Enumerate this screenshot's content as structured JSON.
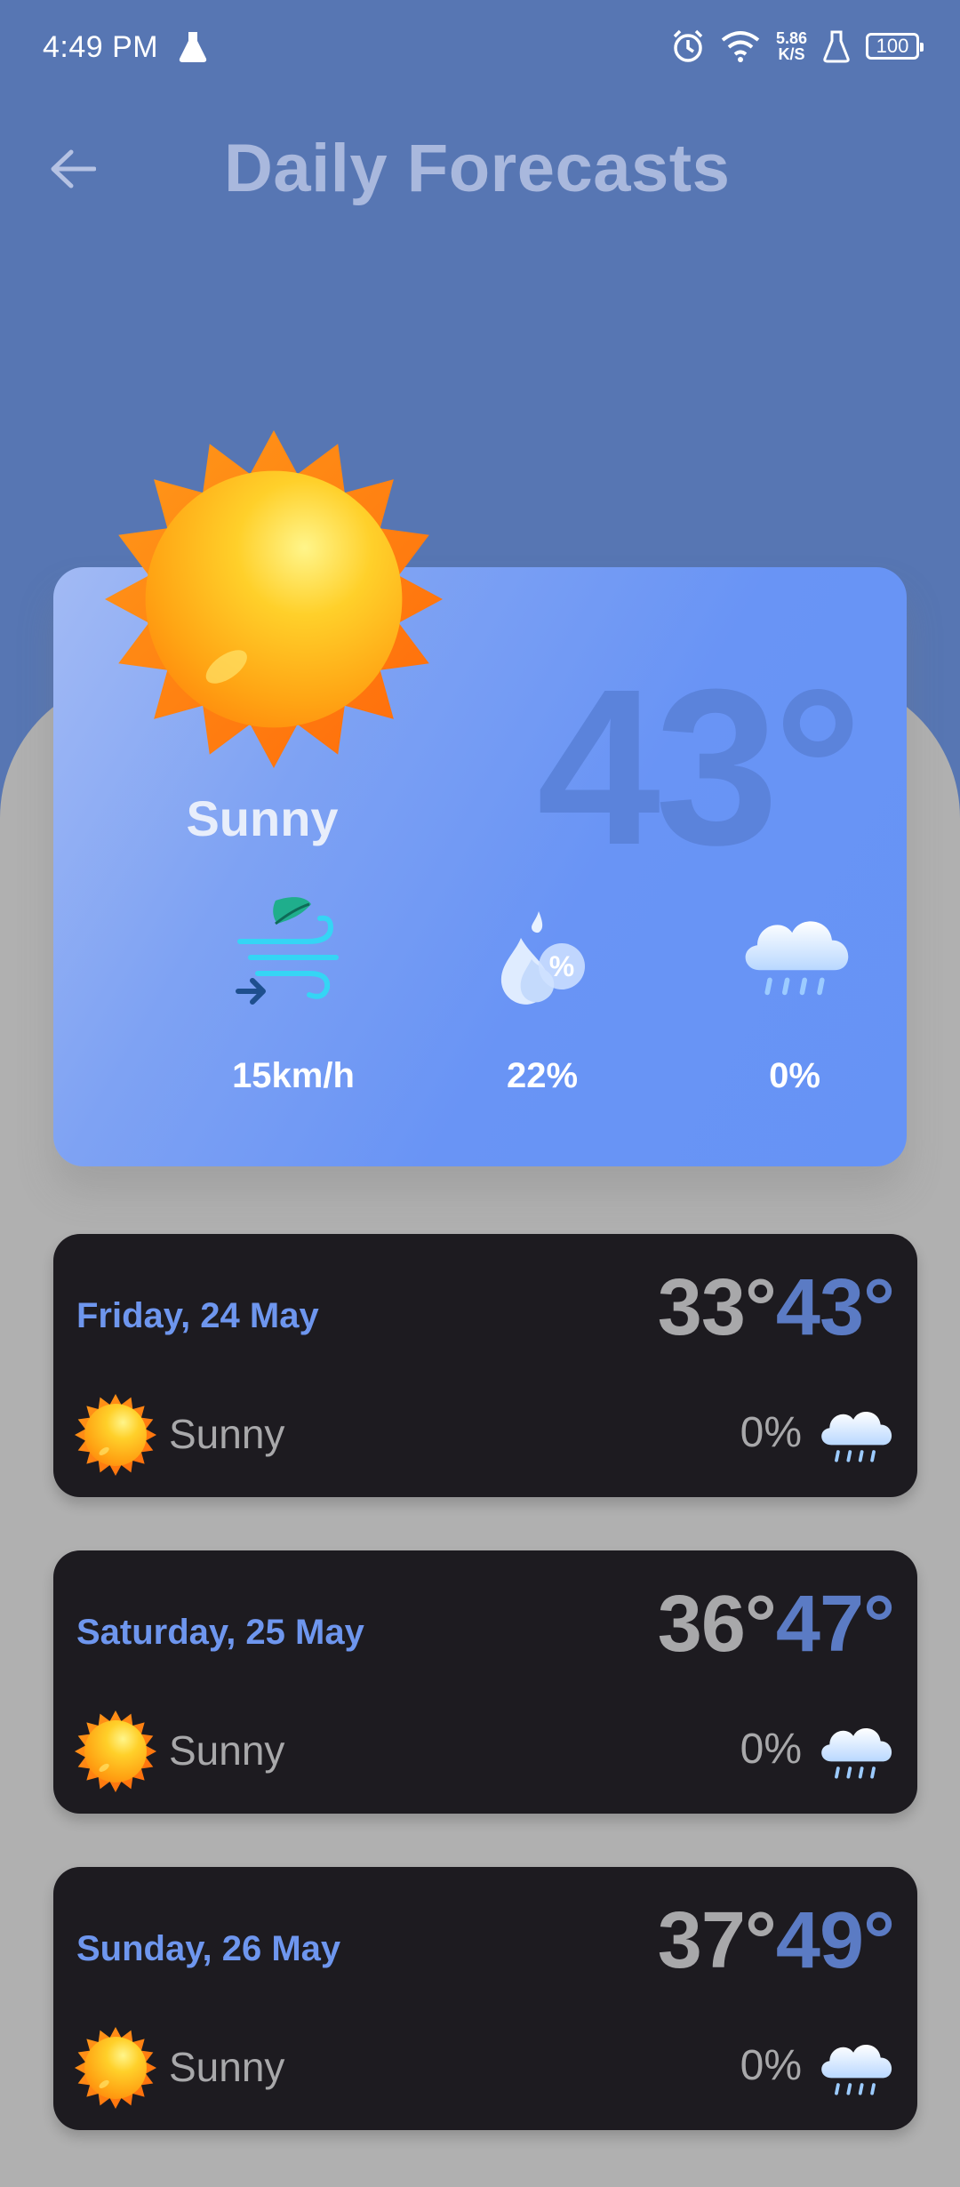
{
  "status_bar": {
    "time": "4:49 PM",
    "speed_value": "5.86",
    "speed_unit": "K/S",
    "battery": "100"
  },
  "header": {
    "title": "Daily Forecasts"
  },
  "today": {
    "temperature": "43°",
    "condition": "Sunny",
    "wind": "15km/h",
    "humidity": "22%",
    "rain_chance": "0%"
  },
  "days": [
    {
      "date": "Friday, 24 May",
      "min": "33°",
      "max": "43°",
      "condition": "Sunny",
      "rain": "0%"
    },
    {
      "date": "Saturday, 25 May",
      "min": "36°",
      "max": "47°",
      "condition": "Sunny",
      "rain": "0%"
    },
    {
      "date": "Sunday, 26 May",
      "min": "37°",
      "max": "49°",
      "condition": "Sunny",
      "rain": "0%"
    }
  ],
  "colors": {
    "header_bg": "#5776B3",
    "page_bg": "#B0B0B0",
    "card_bg": "#1D1B20",
    "accent": "#6E96EE",
    "max_temp": "#5B7BC4"
  },
  "icons": {
    "back": "arrow-left-icon",
    "weather": "sun-icon",
    "wind": "wind-icon",
    "humidity": "humidity-drop-icon",
    "rain": "rain-cloud-icon"
  }
}
